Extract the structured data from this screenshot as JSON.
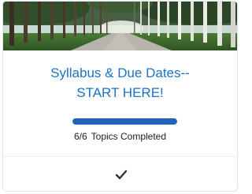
{
  "card": {
    "title_line1": "Syllabus & Due Dates--",
    "title_line2": "START HERE!",
    "progress": {
      "completed": 6,
      "total": 6,
      "count_text": "6/6",
      "label": "Topics Completed",
      "fraction": 1.0
    },
    "banner_icon": "tree-lined-road-image",
    "status_icon": "checkmark-icon",
    "colors": {
      "title": "#1a73c7",
      "progress_fill": "#2164b3",
      "progress_track": "#dfe6ee"
    }
  }
}
